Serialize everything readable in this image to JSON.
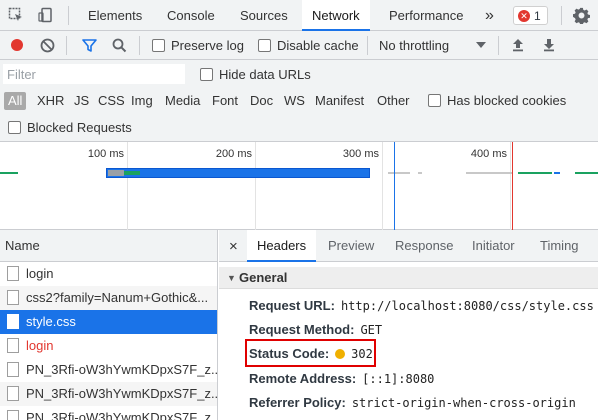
{
  "devtools": {
    "tabs": [
      "Elements",
      "Console",
      "Sources",
      "Network",
      "Performance"
    ],
    "active_tab": "Network",
    "more_tabs_label": "»",
    "error_count": "1",
    "icons": [
      "inspect-icon",
      "device-toolbar-icon",
      "gear-icon"
    ]
  },
  "network_toolbar": {
    "preserve_log": "Preserve log",
    "disable_cache": "Disable cache",
    "throttling": "No throttling",
    "colors": {
      "record": "#e2372f",
      "filter": "#1a73e8"
    }
  },
  "filter": {
    "placeholder": "Filter",
    "hide_data_urls": "Hide data URLs",
    "types": [
      "All",
      "XHR",
      "JS",
      "CSS",
      "Img",
      "Media",
      "Font",
      "Doc",
      "WS",
      "Manifest",
      "Other"
    ],
    "active_type": "All",
    "has_blocked_cookies": "Has blocked cookies",
    "blocked_requests": "Blocked Requests"
  },
  "timeline": {
    "ticks": [
      "100 ms",
      "200 ms",
      "300 ms",
      "400 ms"
    ]
  },
  "request_list": {
    "header": "Name",
    "rows": [
      {
        "name": "login",
        "state": "normal"
      },
      {
        "name": "css2?family=Nanum+Gothic&...",
        "state": "normal"
      },
      {
        "name": "style.css",
        "state": "selected"
      },
      {
        "name": "login",
        "state": "error"
      },
      {
        "name": "PN_3Rfi-oW3hYwmKDpxS7F_z...",
        "state": "normal"
      },
      {
        "name": "PN_3Rfi-oW3hYwmKDpxS7F_z...",
        "state": "normal"
      },
      {
        "name": "PN_3Rfi-oW3hYwmKDpxS7F_z...",
        "state": "normal"
      }
    ]
  },
  "detail": {
    "close": "×",
    "tabs": [
      "Headers",
      "Preview",
      "Response",
      "Initiator",
      "Timing"
    ],
    "active_tab": "Headers",
    "section": "General",
    "fields": {
      "request_url": {
        "key": "Request URL:",
        "value": "http://localhost:8080/css/style.css"
      },
      "request_method": {
        "key": "Request Method:",
        "value": "GET"
      },
      "status_code": {
        "key": "Status Code:",
        "value": "302"
      },
      "remote_address": {
        "key": "Remote Address:",
        "value": "[::1]:8080"
      },
      "referrer_policy": {
        "key": "Referrer Policy:",
        "value": "strict-origin-when-cross-origin"
      }
    }
  }
}
